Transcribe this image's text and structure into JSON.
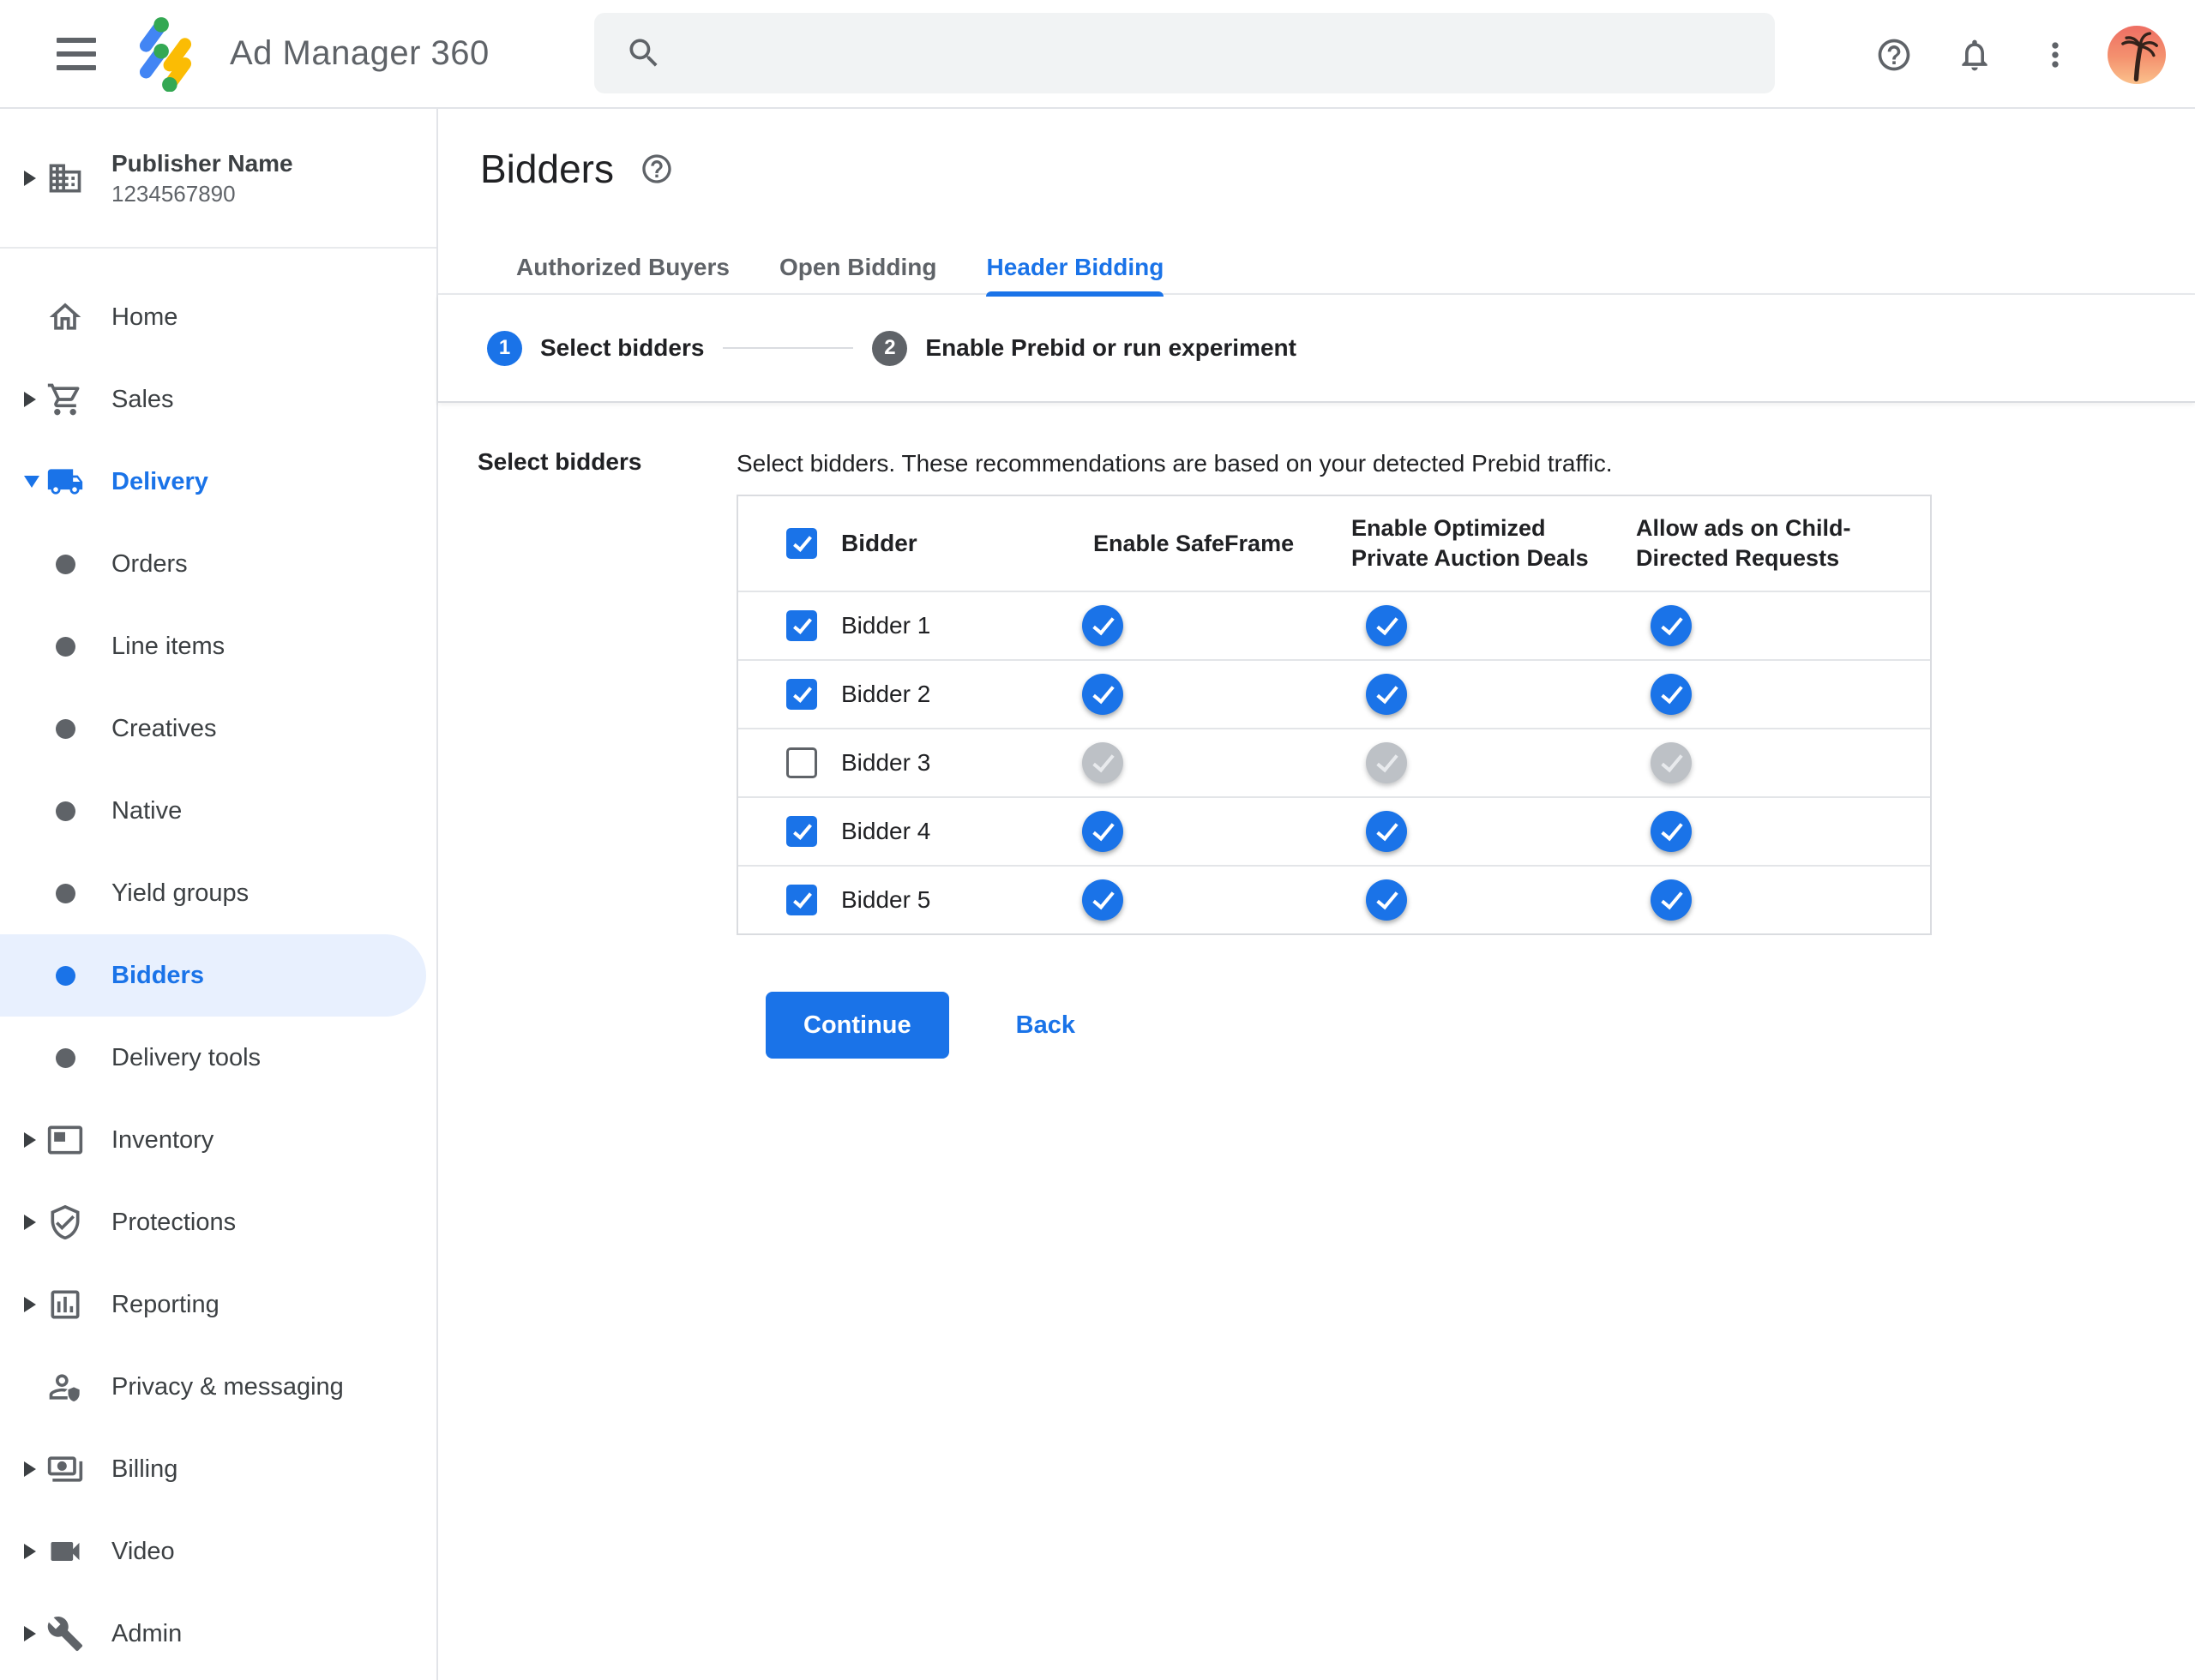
{
  "colors": {
    "accent_blue": "#1a73e8",
    "toggle_track_on": "#93b7f3",
    "toggle_off_thumb": "#bdc1c6",
    "selected_pill": "#e8f0fe",
    "text_dark": "#202124",
    "text_gray": "#5f6368",
    "nav_text": "#3c4043",
    "border": "#dadce0",
    "search_bg": "#f1f3f4",
    "logo_blue": "#4285f4",
    "logo_yellow": "#fbbc04",
    "logo_green": "#34a853"
  },
  "header": {
    "menu_icon": "hamburger-icon",
    "logo_icon": "ad-manager-logo",
    "app_title": "Ad Manager 360",
    "search": {
      "icon": "search-icon",
      "value": "",
      "placeholder": ""
    },
    "actions": [
      {
        "icon": "help-icon"
      },
      {
        "icon": "notifications-bell-icon"
      },
      {
        "icon": "more-vert-icon"
      },
      {
        "icon": "avatar-palm-tree"
      }
    ]
  },
  "sidebar": {
    "publisher": {
      "expand_icon": "caret-right-icon",
      "icon": "building-icon",
      "name": "Publisher Name",
      "id": "1234567890"
    },
    "items": [
      {
        "label": "Home",
        "icon": "home-icon",
        "caret": null,
        "level": "main",
        "active": false,
        "selected": false
      },
      {
        "label": "Sales",
        "icon": "cart-icon",
        "caret": "right",
        "level": "main",
        "active": false,
        "selected": false
      },
      {
        "label": "Delivery",
        "icon": "truck-icon",
        "caret": "down",
        "level": "main",
        "active": true,
        "selected": false
      },
      {
        "label": "Orders",
        "icon": "dot",
        "caret": null,
        "level": "sub",
        "active": false,
        "selected": false
      },
      {
        "label": "Line items",
        "icon": "dot",
        "caret": null,
        "level": "sub",
        "active": false,
        "selected": false
      },
      {
        "label": "Creatives",
        "icon": "dot",
        "caret": null,
        "level": "sub",
        "active": false,
        "selected": false
      },
      {
        "label": "Native",
        "icon": "dot",
        "caret": null,
        "level": "sub",
        "active": false,
        "selected": false
      },
      {
        "label": "Yield groups",
        "icon": "dot",
        "caret": null,
        "level": "sub",
        "active": false,
        "selected": false
      },
      {
        "label": "Bidders",
        "icon": "dot",
        "caret": null,
        "level": "sub",
        "active": false,
        "selected": true
      },
      {
        "label": "Delivery tools",
        "icon": "dot",
        "caret": null,
        "level": "sub",
        "active": false,
        "selected": false
      },
      {
        "label": "Inventory",
        "icon": "inventory-icon",
        "caret": "right",
        "level": "main",
        "active": false,
        "selected": false
      },
      {
        "label": "Protections",
        "icon": "shield-check-icon",
        "caret": "right",
        "level": "main",
        "active": false,
        "selected": false
      },
      {
        "label": "Reporting",
        "icon": "report-chart-icon",
        "caret": "right",
        "level": "main",
        "active": false,
        "selected": false
      },
      {
        "label": "Privacy & messaging",
        "icon": "person-badge-icon",
        "caret": null,
        "level": "main",
        "active": false,
        "selected": false
      },
      {
        "label": "Billing",
        "icon": "billing-icon",
        "caret": "right",
        "level": "main",
        "active": false,
        "selected": false
      },
      {
        "label": "Video",
        "icon": "video-camera-icon",
        "caret": "right",
        "level": "main",
        "active": false,
        "selected": false
      },
      {
        "label": "Admin",
        "icon": "wrench-icon",
        "caret": "right",
        "level": "main",
        "active": false,
        "selected": false
      }
    ]
  },
  "page": {
    "title": "Bidders",
    "help_icon": "help-icon",
    "tabs": [
      {
        "label": "Authorized Buyers",
        "active": false
      },
      {
        "label": "Open Bidding",
        "active": false
      },
      {
        "label": "Header Bidding",
        "active": true
      }
    ],
    "stepper": [
      {
        "number": "1",
        "label": "Select bidders",
        "state": "active"
      },
      {
        "number": "2",
        "label": "Enable Prebid or run experiment",
        "state": "upcoming"
      }
    ],
    "section_label": "Select bidders",
    "description": "Select bidders. These recommendations are based on your detected Prebid traffic.",
    "table": {
      "select_all_checked": true,
      "columns": [
        "Bidder",
        "Enable SafeFrame",
        "Enable Optimized Private Auction Deals",
        "Allow ads on Child-Directed Requests"
      ],
      "rows": [
        {
          "name": "Bidder 1",
          "checked": true,
          "enable_safeframe": true,
          "enable_optimized_deals": true,
          "allow_child_directed": true
        },
        {
          "name": "Bidder 2",
          "checked": true,
          "enable_safeframe": true,
          "enable_optimized_deals": true,
          "allow_child_directed": true
        },
        {
          "name": "Bidder 3",
          "checked": false,
          "enable_safeframe": false,
          "enable_optimized_deals": false,
          "allow_child_directed": false
        },
        {
          "name": "Bidder 4",
          "checked": true,
          "enable_safeframe": true,
          "enable_optimized_deals": true,
          "allow_child_directed": true
        },
        {
          "name": "Bidder 5",
          "checked": true,
          "enable_safeframe": true,
          "enable_optimized_deals": true,
          "allow_child_directed": true
        }
      ]
    },
    "buttons": {
      "continue": "Continue",
      "back": "Back"
    }
  }
}
